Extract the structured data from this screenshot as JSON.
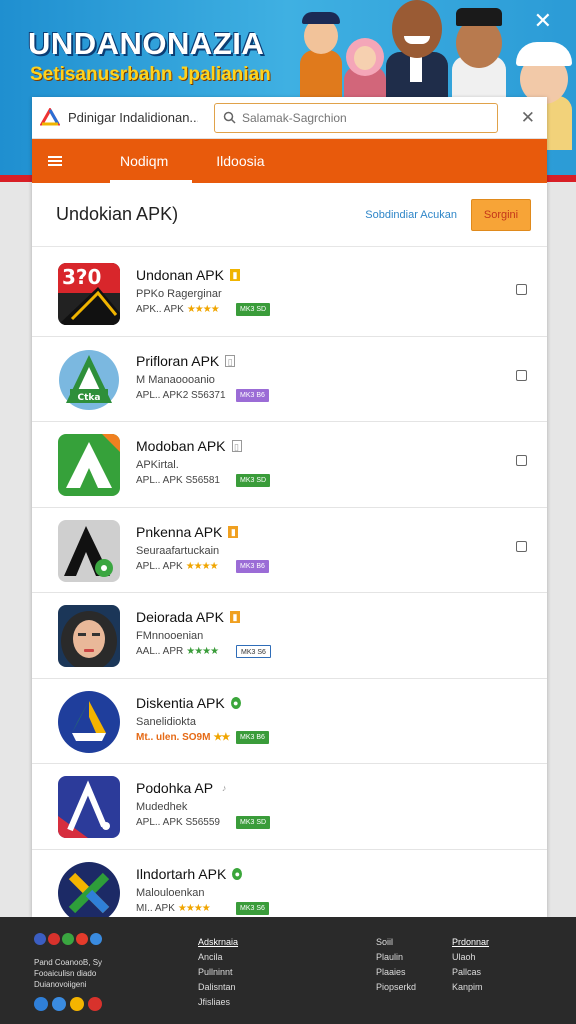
{
  "banner": {
    "title": "UNDANONAZIA",
    "subtitle": "Setisanusrbahn Jpalianian",
    "close_glyph": "✕"
  },
  "topbar": {
    "app_name": "Pdinigar Indalidionan...",
    "search_placeholder": "Salamak-Sagrchion",
    "close_glyph": "✕"
  },
  "nav": {
    "tabs": [
      "Nodiqm",
      "Ildoosia"
    ]
  },
  "heading": {
    "title": "Undokian APK)",
    "link": "Sobdindiar Acukan",
    "button": "Sorgini"
  },
  "apps": [
    {
      "title": "Undonan APK",
      "developer": "PPKo Ragerginar",
      "meta": "APK.. APK",
      "stars": "★★★★",
      "badge": "MK3 SD",
      "badge_color": "#3a9c3a",
      "mini_color": "#f0b400"
    },
    {
      "title": "Prifloran APK",
      "developer": "M Manaoooanio",
      "meta": "APL.. APK2 S56371",
      "stars": "",
      "badge": "MK3 B6",
      "badge_color": "#9b6cd6",
      "mini_color": "#999"
    },
    {
      "title": "Modoban APK",
      "developer": "APKirtal.",
      "meta": "APL.. APK S56581",
      "stars": "",
      "badge": "MK3 SD",
      "badge_color": "#3a9c3a",
      "mini_color": "#999"
    },
    {
      "title": "Pnkenna APK",
      "developer": "Seuraafartuckain",
      "meta": "APL.. APK",
      "stars": "★★★★",
      "badge": "MK3 B6",
      "badge_color": "#9b6cd6",
      "mini_color": "#f0a020"
    },
    {
      "title": "Deiorada APK",
      "developer": "FMnnooenian",
      "meta": "AAL.. APR",
      "stars": "★★★★",
      "badge": "MK3 S6",
      "badge_color": "#ffffff",
      "mini_color": "#f0a020"
    },
    {
      "title": "Diskentia APK",
      "developer": "Sanelidiokta",
      "meta": "Mt.. ulen. SO9M",
      "stars": "★★",
      "badge": "MK3 B6",
      "badge_color": "#3a9c3a",
      "mini_color": "#3ba63b"
    },
    {
      "title": "Podohka AP",
      "developer": "Mudedhek",
      "meta": "APL.. APK S56559",
      "stars": "",
      "badge": "MK3 SD",
      "badge_color": "#3a9c3a",
      "mini_color": "#999"
    },
    {
      "title": "Ilndortarh APK",
      "developer": "Malouloenkan",
      "meta": "MI.. APK",
      "stars": "★★★★",
      "badge": "MK3 S6",
      "badge_color": "#3a9c3a",
      "mini_color": "#3ba63b"
    }
  ],
  "footer": {
    "small_text": [
      "Pand CoanooB, Sy",
      "Fooaiculisn diado",
      "Duianovoiigeni"
    ],
    "col1": [
      "Adskrnaia",
      "Ancila",
      "Pullninnt",
      "Dalisntan",
      "Jfisliaes"
    ],
    "col2": [
      "Soiil",
      "Plaulin",
      "Plaaies",
      "Piopserkd"
    ],
    "col3": [
      "Prdonnar",
      "Ulaoh",
      "Pallcas",
      "Kanpim"
    ]
  }
}
